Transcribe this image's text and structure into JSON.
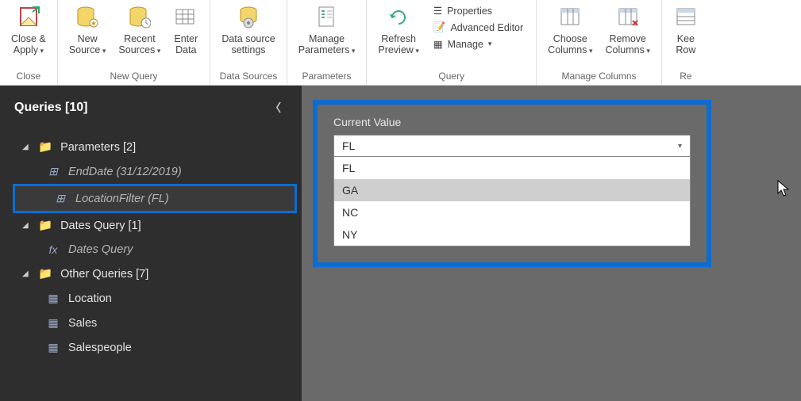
{
  "ribbon": {
    "close_apply": "Close &\nApply",
    "new_source": "New\nSource",
    "recent_sources": "Recent\nSources",
    "enter_data": "Enter\nData",
    "data_source_settings": "Data source\nsettings",
    "manage_parameters": "Manage\nParameters",
    "refresh_preview": "Refresh\nPreview",
    "properties": "Properties",
    "advanced_editor": "Advanced Editor",
    "manage": "Manage",
    "choose_columns": "Choose\nColumns",
    "remove_columns": "Remove\nColumns",
    "keep_rows": "Kee\nRow",
    "group_close": "Close",
    "group_new_query": "New Query",
    "group_data_sources": "Data Sources",
    "group_parameters": "Parameters",
    "group_query": "Query",
    "group_manage_columns": "Manage Columns",
    "group_reduce": "Re"
  },
  "sidebar": {
    "title": "Queries [10]",
    "parameters_group": "Parameters [2]",
    "enddate": "EndDate (31/12/2019)",
    "locationfilter": "LocationFilter (FL)",
    "dates_group": "Dates Query [1]",
    "dates_query": "Dates Query",
    "other_group": "Other Queries [7]",
    "location": "Location",
    "sales": "Sales",
    "salespeople": "Salespeople"
  },
  "panel": {
    "label": "Current Value",
    "selected": "FL",
    "options": [
      "FL",
      "GA",
      "NC",
      "NY"
    ],
    "hover_index": 1
  }
}
